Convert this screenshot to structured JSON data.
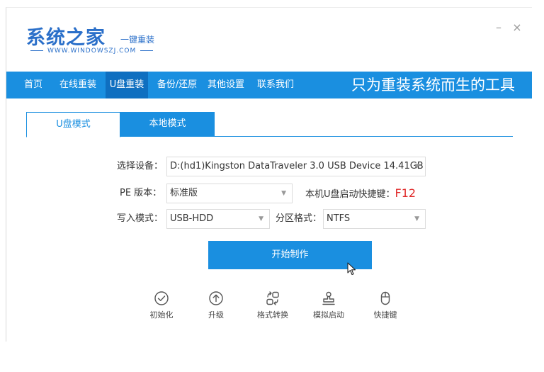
{
  "logo": {
    "title": "系统之家",
    "subtitle": "一键重装",
    "url": "WWW.WINDOWSZJ.COM"
  },
  "window_controls": {
    "minimize": "–",
    "close": "×"
  },
  "nav": {
    "items": [
      {
        "label": "首页"
      },
      {
        "label": "在线重装"
      },
      {
        "label": "U盘重装"
      },
      {
        "label": "备份/还原"
      },
      {
        "label": "其他设置"
      },
      {
        "label": "联系我们"
      }
    ],
    "active_index": 2,
    "slogan": "只为重装系统而生的工具"
  },
  "tabs": [
    {
      "label": "U盘模式"
    },
    {
      "label": "本地模式"
    }
  ],
  "form": {
    "device_label": "选择设备：",
    "device_value": "D:(hd1)Kingston DataTraveler 3.0 USB Device 14.41GB",
    "pe_label": "PE 版本：",
    "pe_value": "标准版",
    "hotkey_label": "本机U盘启动快捷键：",
    "hotkey_value": "F12",
    "write_mode_label": "写入模式：",
    "write_mode_value": "USB-HDD",
    "partition_label": "分区格式：",
    "partition_value": "NTFS"
  },
  "start_button": {
    "label": "开始制作"
  },
  "tools": [
    {
      "label": "初始化",
      "icon": "check-circle-icon"
    },
    {
      "label": "升级",
      "icon": "upgrade-icon"
    },
    {
      "label": "格式转换",
      "icon": "convert-icon"
    },
    {
      "label": "模拟启动",
      "icon": "stamp-icon"
    },
    {
      "label": "快捷键",
      "icon": "mouse-icon"
    }
  ],
  "colors": {
    "accent": "#1a8fe0",
    "accent_dark": "#0f6fc0",
    "hotkey": "#e02a2a"
  }
}
